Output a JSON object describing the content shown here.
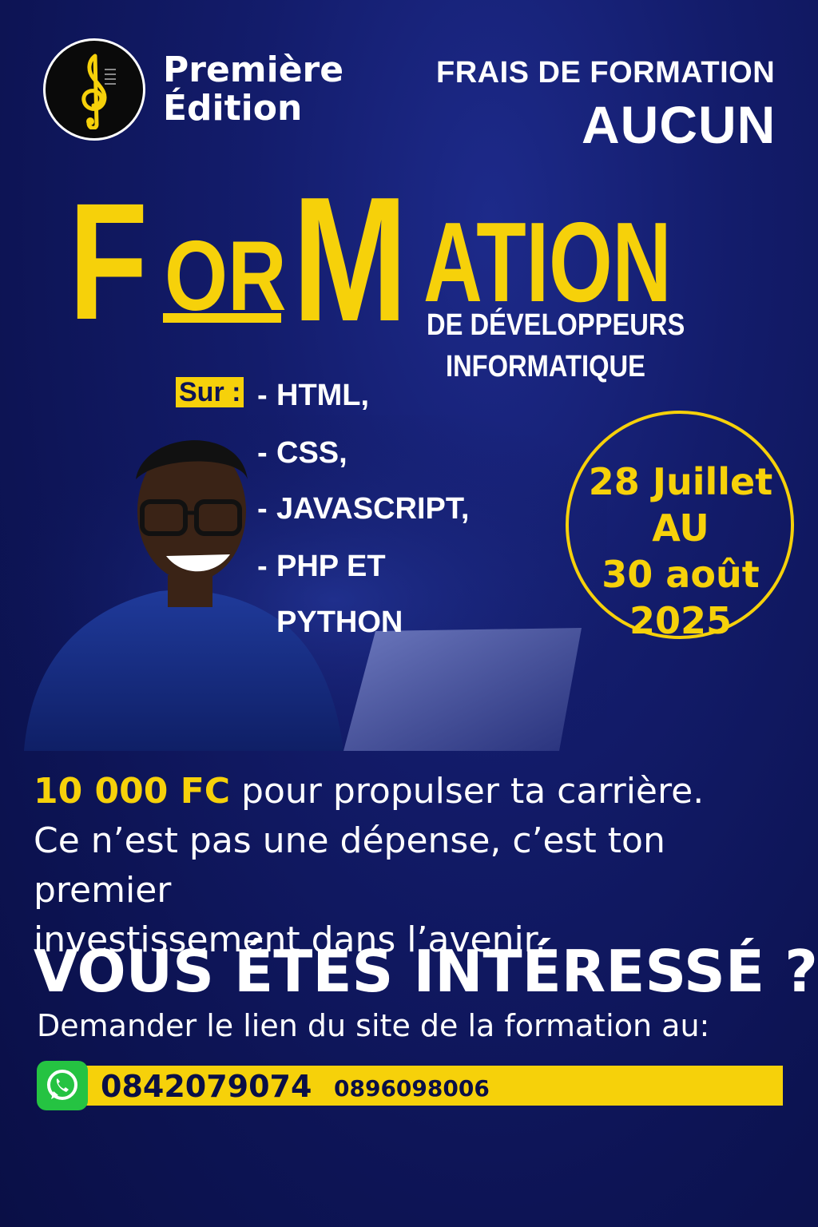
{
  "header": {
    "logo_icon": "treble-clef-icon",
    "edition_line1": "Première",
    "edition_line2": "Édition",
    "fees_label": "FRAIS DE FORMATION",
    "fees_value": "AUCUN"
  },
  "title": {
    "part_f": "F",
    "part_or": "OR",
    "part_m": "M",
    "part_ation": "ATION",
    "subtitle_line1": "DE DÉVELOPPEURS",
    "subtitle_line2": "INFORMATIQUE"
  },
  "courses": {
    "label": "Sur :",
    "items": [
      "HTML,",
      "CSS,",
      "JAVASCRIPT,",
      "PHP ET",
      "PYTHON"
    ]
  },
  "dates": {
    "line1": "28 Juillet",
    "line2": "AU",
    "line3": "30 août",
    "line4": "2025"
  },
  "pitch": {
    "price": "10 000 FC",
    "line1_rest": " pour propulser ta carrière.",
    "line2": "Ce n’est pas une dépense, c’est ton premier",
    "line3": "investissement dans l’avenir."
  },
  "cta": {
    "headline": "VOUS ÉTES INTÉRESSÉ ?",
    "subline": "Demander le lien du site de la formation au:"
  },
  "contact": {
    "icon": "whatsapp-icon",
    "phone_primary": "0842079074",
    "phone_secondary": "0896098006"
  },
  "colors": {
    "background": "#0d1455",
    "accent": "#f6d10a",
    "whatsapp": "#25c342"
  }
}
